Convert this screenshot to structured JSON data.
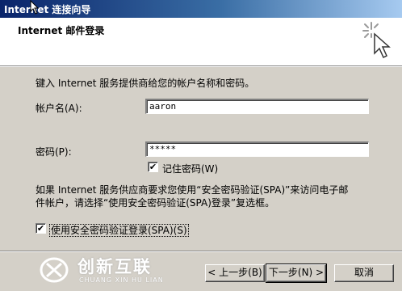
{
  "window": {
    "title": "Internet 连接向导"
  },
  "header": {
    "title": "Internet 邮件登录"
  },
  "body": {
    "instruction": "键入 Internet 服务提供商给您的帐户名称和密码。",
    "account_label": "帐户名(A):",
    "account_value": "aaron",
    "password_label": "密码(P):",
    "password_value": "*****",
    "remember_label": "记住密码(W)",
    "remember_checked": "✔",
    "spa_note_line1": "如果 Internet 服务供应商要求您使用“安全密码验证(SPA)”来访问电子邮",
    "spa_note_line2": "件帐户，请选择“使用安全密码验证(SPA)登录”复选框。",
    "spa_label": "使用安全密码验证登录(SPA)(S)",
    "spa_checked": "✔"
  },
  "buttons": {
    "back": "< 上一步(B)",
    "next": "下一步(N) >",
    "cancel": "取消"
  },
  "watermark": {
    "name": "创新互联",
    "sub": "CHUANG XIN HU LIAN"
  }
}
